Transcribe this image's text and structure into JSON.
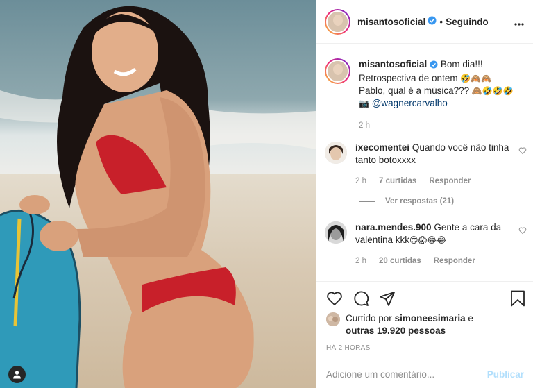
{
  "post": {
    "username": "misantosoficial",
    "follow_status": "Seguindo",
    "caption_line1": "Bom dia!!!",
    "caption_line2": "Retrospectiva de ontem",
    "caption_line2_emoji": "🤣🙈🙈",
    "caption_line3": "Pablo, qual é a música???",
    "caption_line3_emoji": "🙈🤣🤣🤣",
    "photo_credit_emoji": "📷",
    "photo_credit": "@wagnercarvalho",
    "caption_time": "2 h"
  },
  "comments": [
    {
      "username": "ixecomentei",
      "text": "Quando você não tinha tanto botoxxxx",
      "time": "2 h",
      "likes": "7 curtidas",
      "reply": "Responder",
      "replies": "Ver respostas (21)"
    },
    {
      "username": "nara.mendes.900",
      "text": "Gente a cara da valentina kkk",
      "emoji": "😍😱😂😂",
      "time": "2 h",
      "likes": "20 curtidas",
      "reply": "Responder"
    }
  ],
  "likes": {
    "prefix": "Curtido por",
    "user": "simoneesimaria",
    "and": "e",
    "others": "outras 19.920 pessoas"
  },
  "post_age": "HÁ 2 HORAS",
  "comment_box": {
    "placeholder": "Adicione um comentário...",
    "publish": "Publicar"
  },
  "icons": [
    "verified-icon",
    "more-icon",
    "heart-icon",
    "comment-icon",
    "share-icon",
    "bookmark-icon",
    "user-icon"
  ],
  "colors": {
    "verified": "#3897f0",
    "link": "#00376b",
    "muted": "#8e8e8e",
    "publish_disabled": "#b2dffc"
  }
}
